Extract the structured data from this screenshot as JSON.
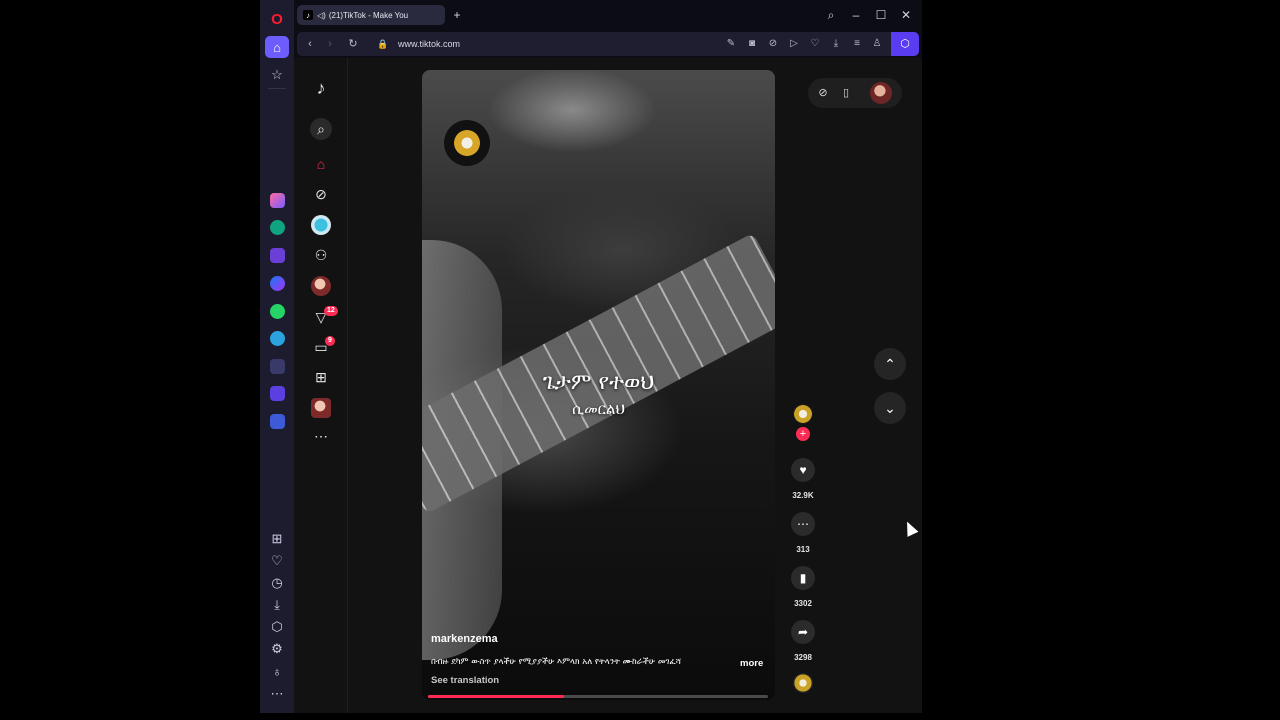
{
  "browser": {
    "tab_title": "(21)TikTok - Make You",
    "url": "www.tiktok.com",
    "brand_color": "#ff1b2d",
    "accent_color": "#6d5dfc"
  },
  "opera_sidebar": {
    "icons": [
      "opera-logo",
      "home-icon",
      "star-icon",
      "aria-icon",
      "chatgpt-icon",
      "cs-app-icon",
      "messenger-icon",
      "whatsapp-icon",
      "telegram-icon",
      "music-icon",
      "player-icon",
      "workspace-icon",
      "grid-icon",
      "heart-icon",
      "history-icon",
      "download-icon",
      "cube-icon",
      "settings-icon",
      "bulb-icon",
      "more-icon"
    ]
  },
  "tiktok": {
    "accent_color": "#fe2c55",
    "nav": {
      "activity_badge": "12",
      "messages_badge": "9"
    },
    "video": {
      "overlay_title": "ጌታም የተወህ",
      "overlay_subtitle": "ሲመርልህ",
      "username": "markenzema",
      "description": "በብዙ ደካም ውስጥ ያላችሁ የሚያያችሁ እምላክ አለ የትላንት ሙከራችሁ መገፈሻ",
      "more_label": "more",
      "see_translation": "See translation",
      "progress_percent": 40
    },
    "actions": {
      "likes": "32.9K",
      "comments": "313",
      "saves": "3302",
      "shares": "3298"
    }
  }
}
